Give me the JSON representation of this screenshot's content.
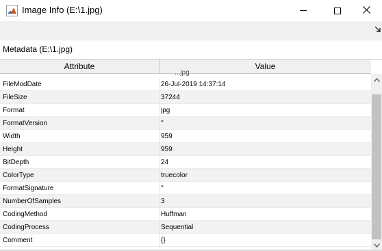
{
  "window": {
    "title": "Image Info (E:\\1.jpg)"
  },
  "metadata_label": "Metadata (E:\\1.jpg)",
  "table": {
    "headers": [
      "Attribute",
      "Value"
    ],
    "partial_row_text": "...jpg",
    "rows": [
      {
        "attribute": "FileModDate",
        "value": "26-Jul-2019 14:37:14"
      },
      {
        "attribute": "FileSize",
        "value": "37244"
      },
      {
        "attribute": "Format",
        "value": "jpg"
      },
      {
        "attribute": "FormatVersion",
        "value": "''"
      },
      {
        "attribute": "Width",
        "value": "959"
      },
      {
        "attribute": "Height",
        "value": "959"
      },
      {
        "attribute": "BitDepth",
        "value": "24"
      },
      {
        "attribute": "ColorType",
        "value": "truecolor"
      },
      {
        "attribute": "FormatSignature",
        "value": "''"
      },
      {
        "attribute": "NumberOfSamples",
        "value": "3"
      },
      {
        "attribute": "CodingMethod",
        "value": "Huffman"
      },
      {
        "attribute": "CodingProcess",
        "value": "Sequential"
      },
      {
        "attribute": "Comment",
        "value": "{}"
      }
    ]
  },
  "icons": {
    "app": "matlab-logo-icon",
    "minimize": "minimize-icon",
    "maximize": "maximize-icon",
    "close": "close-icon",
    "dock": "dock-arrow-icon",
    "scroll_up": "scroll-up-icon",
    "scroll_down": "scroll-down-icon"
  },
  "colors": {
    "header_bg": "#f0f0f0",
    "alt_row_bg": "#f2f2f2",
    "scroll_thumb": "#c2c2c2"
  }
}
